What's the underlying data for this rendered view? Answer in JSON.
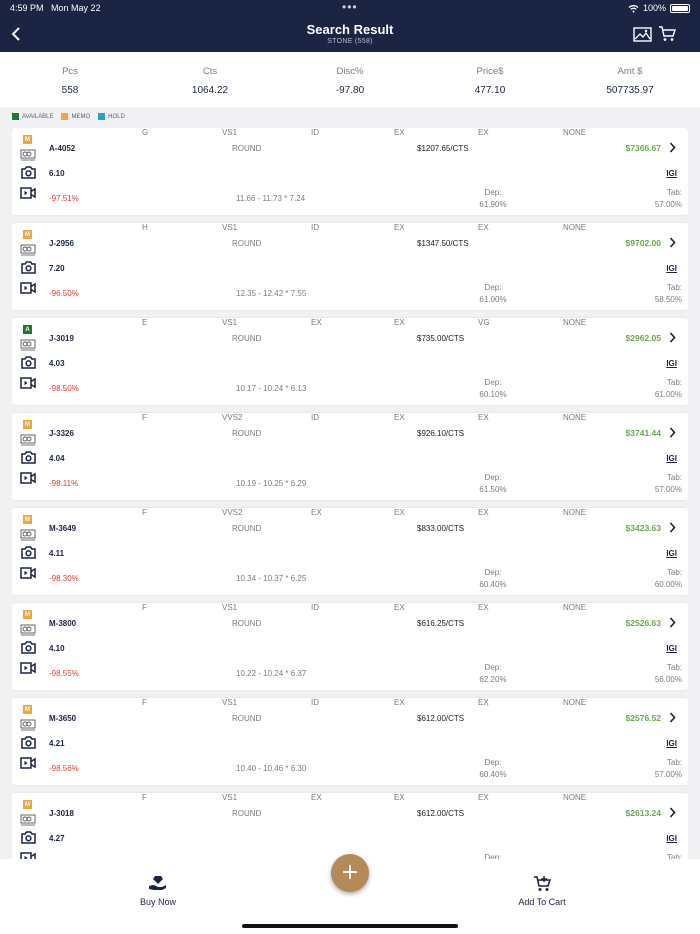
{
  "status_bar": {
    "time": "4:59 PM",
    "date": "Mon May 22",
    "dots": "•••",
    "battery": "100%"
  },
  "header": {
    "title": "Search Result",
    "subtitle": "STONE (558)",
    "icons": [
      "back-chevron-icon",
      "image-icon",
      "cart-icon"
    ]
  },
  "summary": [
    {
      "label": "Pcs",
      "value": "558"
    },
    {
      "label": "Cts",
      "value": "1064.22"
    },
    {
      "label": "Disc%",
      "value": "-97.80"
    },
    {
      "label": "Price$",
      "value": "477.10"
    },
    {
      "label": "Amt $",
      "value": "507735.97"
    }
  ],
  "legend": [
    {
      "label": "AVAILABLE",
      "color": "#1e7a2e"
    },
    {
      "label": "MEMO",
      "color": "#f0a640"
    },
    {
      "label": "HOLD",
      "color": "#2d9be0"
    }
  ],
  "colors": {
    "navy": "#1b2443",
    "green_amount": "#6aa84f",
    "red_discount": "#e0403b",
    "fab": "#b48a58"
  },
  "stones": [
    {
      "status": "M",
      "status_color": "#f0a640",
      "stone_id": "A-4052",
      "shape": "ROUND",
      "rate": "$1207.65/CTS",
      "amount": "$7366.67",
      "carat": "6.10",
      "color": "G",
      "clarity": "VS1",
      "cut": "ID",
      "polish": "EX",
      "symmetry": "EX",
      "fluorescence": "NONE",
      "lab": "IGI",
      "discount": "-97.51%",
      "measurements": "11.66 - 11.73 * 7.24",
      "depth_label": "Dep:",
      "depth": "61.90%",
      "table_label": "Tab:",
      "table": "57.00%"
    },
    {
      "status": "M",
      "status_color": "#f0a640",
      "stone_id": "J-2956",
      "shape": "ROUND",
      "rate": "$1347.50/CTS",
      "amount": "$9702.00",
      "carat": "7.20",
      "color": "H",
      "clarity": "VS1",
      "cut": "ID",
      "polish": "EX",
      "symmetry": "EX",
      "fluorescence": "NONE",
      "lab": "IGI",
      "discount": "-96.50%",
      "measurements": "12.35 - 12.42 * 7.55",
      "depth_label": "Dep:",
      "depth": "61.00%",
      "table_label": "Tab:",
      "table": "58.50%"
    },
    {
      "status": "A",
      "status_color": "#1e7a2e",
      "stone_id": "J-3019",
      "shape": "ROUND",
      "rate": "$735.00/CTS",
      "amount": "$2962.05",
      "carat": "4.03",
      "color": "E",
      "clarity": "VS1",
      "cut": "EX",
      "polish": "EX",
      "symmetry": "VG",
      "fluorescence": "NONE",
      "lab": "IGI",
      "discount": "-98.50%",
      "measurements": "10.17 - 10.24 * 6.13",
      "depth_label": "Dep:",
      "depth": "60.10%",
      "table_label": "Tab:",
      "table": "61.00%"
    },
    {
      "status": "M",
      "status_color": "#f0a640",
      "stone_id": "J-3326",
      "shape": "ROUND",
      "rate": "$926.10/CTS",
      "amount": "$3741.44",
      "carat": "4.04",
      "color": "F",
      "clarity": "VVS2",
      "cut": "ID",
      "polish": "EX",
      "symmetry": "EX",
      "fluorescence": "NONE",
      "lab": "IGI",
      "discount": "-98.11%",
      "measurements": "10.19 - 10.25 * 6.29",
      "depth_label": "Dep:",
      "depth": "61.50%",
      "table_label": "Tab:",
      "table": "57.00%"
    },
    {
      "status": "M",
      "status_color": "#f0a640",
      "stone_id": "M-3649",
      "shape": "ROUND",
      "rate": "$833.00/CTS",
      "amount": "$3423.63",
      "carat": "4.11",
      "color": "F",
      "clarity": "VVS2",
      "cut": "EX",
      "polish": "EX",
      "symmetry": "EX",
      "fluorescence": "NONE",
      "lab": "IGI",
      "discount": "-98.30%",
      "measurements": "10.34 - 10.37 * 6.25",
      "depth_label": "Dep:",
      "depth": "60.40%",
      "table_label": "Tab:",
      "table": "60.00%"
    },
    {
      "status": "M",
      "status_color": "#f0a640",
      "stone_id": "M-3800",
      "shape": "ROUND",
      "rate": "$616.25/CTS",
      "amount": "$2526.63",
      "carat": "4.10",
      "color": "F",
      "clarity": "VS1",
      "cut": "ID",
      "polish": "EX",
      "symmetry": "EX",
      "fluorescence": "NONE",
      "lab": "IGI",
      "discount": "-98.55%",
      "measurements": "10.22 - 10.24 * 6.37",
      "depth_label": "Dep:",
      "depth": "62.20%",
      "table_label": "Tab:",
      "table": "56.00%"
    },
    {
      "status": "M",
      "status_color": "#f0a640",
      "stone_id": "M-3650",
      "shape": "ROUND",
      "rate": "$612.00/CTS",
      "amount": "$2576.52",
      "carat": "4.21",
      "color": "F",
      "clarity": "VS1",
      "cut": "ID",
      "polish": "EX",
      "symmetry": "EX",
      "fluorescence": "NONE",
      "lab": "IGI",
      "discount": "-98.56%",
      "measurements": "10.40 - 10.46 * 6.30",
      "depth_label": "Dep:",
      "depth": "60.40%",
      "table_label": "Tab:",
      "table": "57.00%"
    },
    {
      "status": "M",
      "status_color": "#f0a640",
      "stone_id": "J-3018",
      "shape": "ROUND",
      "rate": "$612.00/CTS",
      "amount": "$2613.24",
      "carat": "4.27",
      "color": "F",
      "clarity": "VS1",
      "cut": "EX",
      "polish": "EX",
      "symmetry": "EX",
      "fluorescence": "NONE",
      "lab": "IGI",
      "discount": "",
      "measurements": "",
      "depth_label": "Dep:",
      "depth": "",
      "table_label": "Tab:",
      "table": ""
    }
  ],
  "bottom_bar": {
    "buy_now": "Buy Now",
    "add_to_cart": "Add To Cart",
    "fab": "+"
  }
}
